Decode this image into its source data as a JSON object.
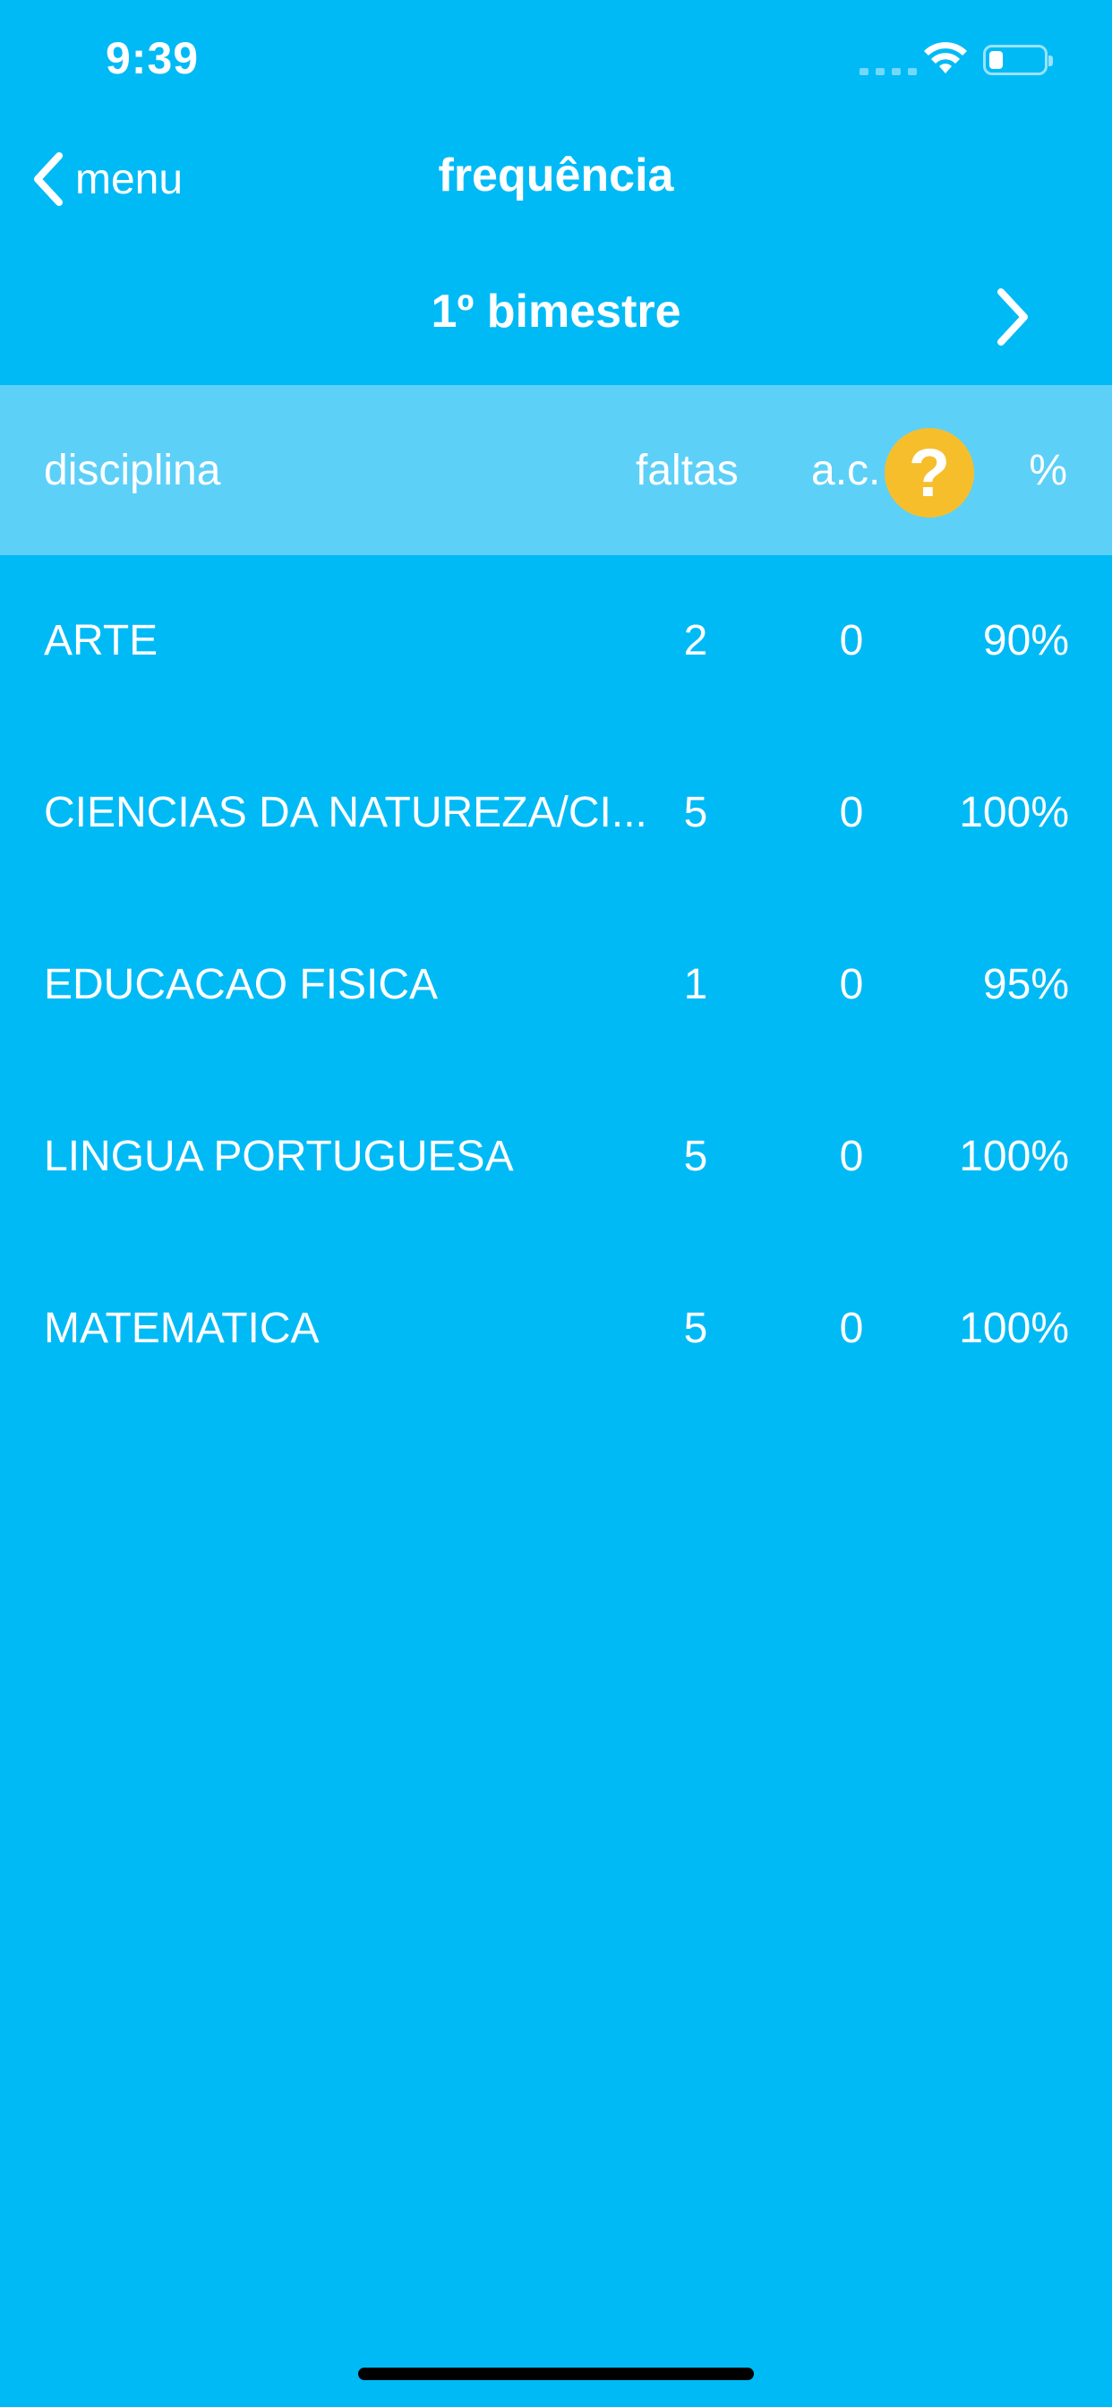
{
  "status_bar": {
    "time": "9:39"
  },
  "nav": {
    "back_label": "menu",
    "title": "frequência"
  },
  "period": {
    "title": "1º bimestre"
  },
  "table": {
    "headers": {
      "disciplina": "disciplina",
      "faltas": "faltas",
      "ac": "a.c.",
      "help": "?",
      "percent": "%"
    },
    "rows": [
      {
        "name": "ARTE",
        "faltas": "2",
        "ac": "0",
        "percent": "90%"
      },
      {
        "name": "CIENCIAS DA NATUREZA/CI...",
        "faltas": "5",
        "ac": "0",
        "percent": "100%"
      },
      {
        "name": "EDUCACAO FISICA",
        "faltas": "1",
        "ac": "0",
        "percent": "95%"
      },
      {
        "name": "LINGUA PORTUGUESA",
        "faltas": "5",
        "ac": "0",
        "percent": "100%"
      },
      {
        "name": "MATEMATICA",
        "faltas": "5",
        "ac": "0",
        "percent": "100%"
      }
    ]
  },
  "colors": {
    "background": "#00BAF6",
    "header_band": "#5DD0F8",
    "help_icon": "#F7BE2C",
    "text": "#FFFFFF"
  },
  "icons": {
    "back": "chevron-left-icon",
    "next": "chevron-right-icon",
    "help": "question-icon",
    "wifi": "wifi-icon",
    "battery": "battery-icon",
    "signal": "cellular-signal-icon"
  }
}
